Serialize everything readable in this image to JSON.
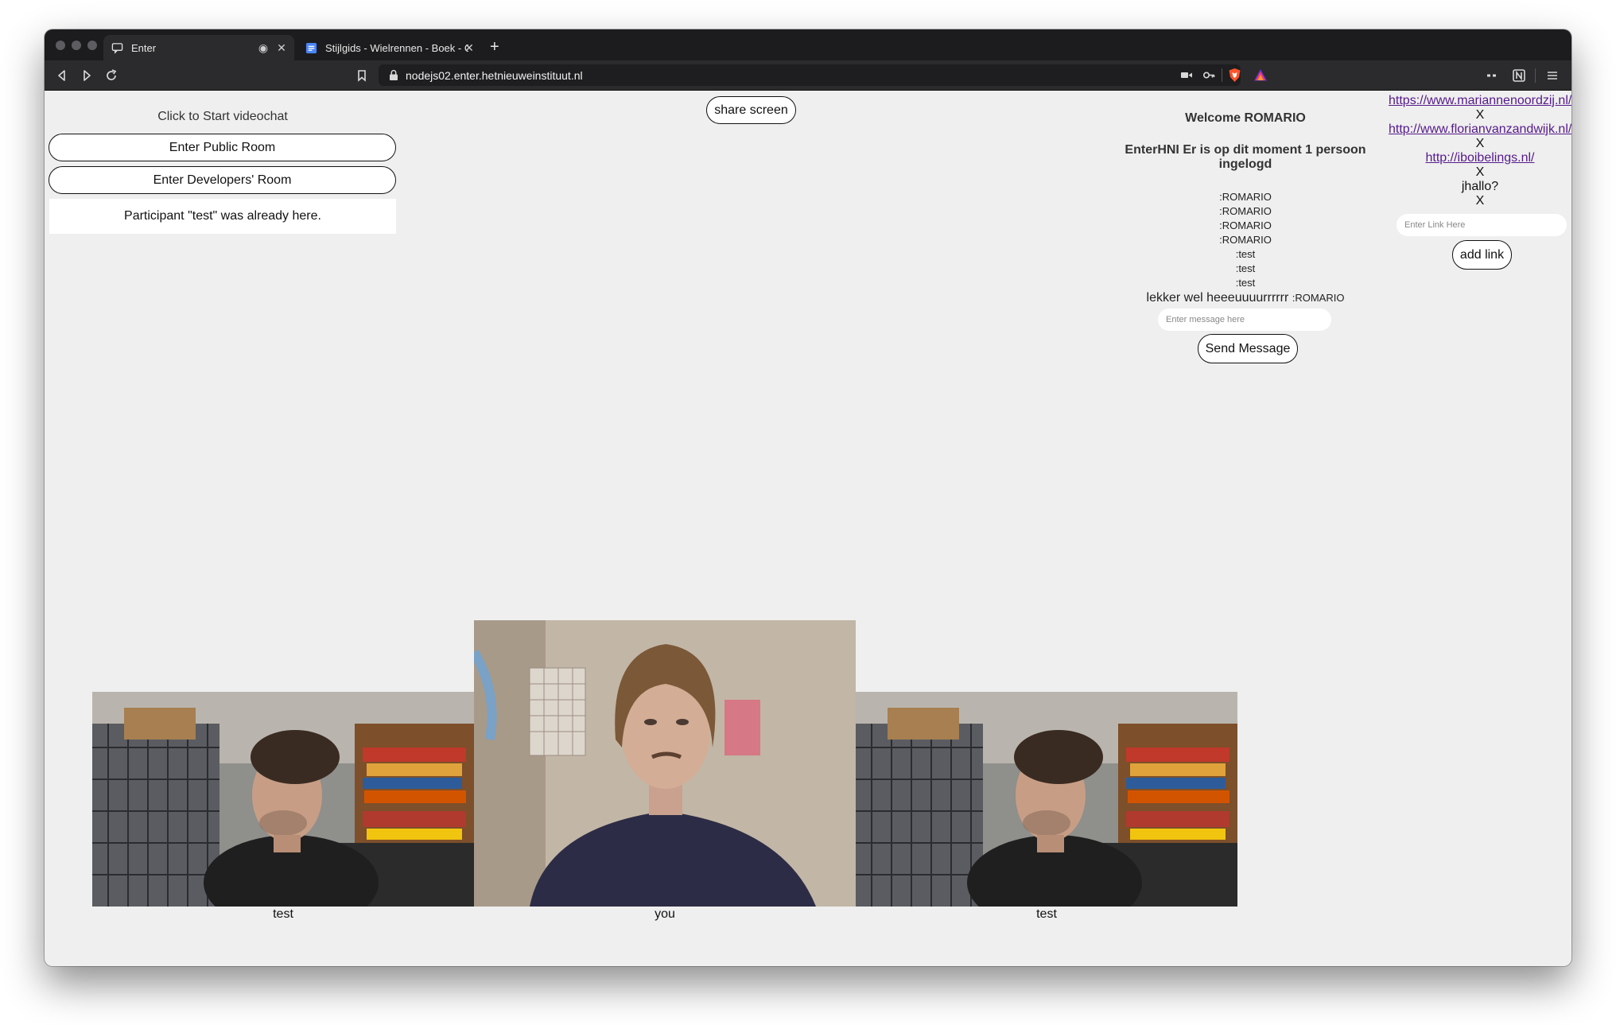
{
  "browser": {
    "tabs": [
      {
        "title": "Enter",
        "favicon": "chat-icon",
        "active": true
      },
      {
        "title": "Stijlgids - Wielrennen - Boek - G",
        "favicon": "docs-icon",
        "active": false
      }
    ],
    "url": "nodejs02.enter.hetnieuweinstituut.nl"
  },
  "left_panel": {
    "start_label": "Click to Start videochat",
    "public_room_label": "Enter Public Room",
    "dev_room_label": "Enter Developers' Room",
    "notice": "Participant \"test\" was already here."
  },
  "share_screen_label": "share screen",
  "chat": {
    "welcome": "Welcome ROMARIO",
    "online_status": "EnterHNI Er is op dit moment 1 persoon ingelogd",
    "messages": [
      {
        "text": ":ROMARIO"
      },
      {
        "text": ":ROMARIO"
      },
      {
        "text": ":ROMARIO"
      },
      {
        "text": ":ROMARIO"
      },
      {
        "text": ":test"
      },
      {
        "text": ":test"
      },
      {
        "text": ":test"
      },
      {
        "text": "lekker wel heeeuuuurrrrrr",
        "author": ":ROMARIO"
      }
    ],
    "input_placeholder": "Enter message here",
    "send_label": "Send Message"
  },
  "links": {
    "items": [
      {
        "text": "https://www.mariannenoordzij.nl/",
        "is_link": true,
        "remove": "X"
      },
      {
        "text": "http://www.florianvanzandwijk.nl/",
        "is_link": true,
        "remove": "X"
      },
      {
        "text": "http://iboibelings.nl/",
        "is_link": true,
        "remove": "X"
      },
      {
        "text": "jhallo?",
        "is_link": false,
        "remove": "X"
      }
    ],
    "input_placeholder": "Enter Link Here",
    "add_label": "add link"
  },
  "videos": [
    {
      "caption": "test"
    },
    {
      "caption": "you"
    },
    {
      "caption": "test"
    }
  ],
  "colors": {
    "page_bg": "#efefef",
    "chrome_dark": "#1c1c1e",
    "toolbar": "#2b2b2d",
    "link_visited": "#551a8b"
  }
}
